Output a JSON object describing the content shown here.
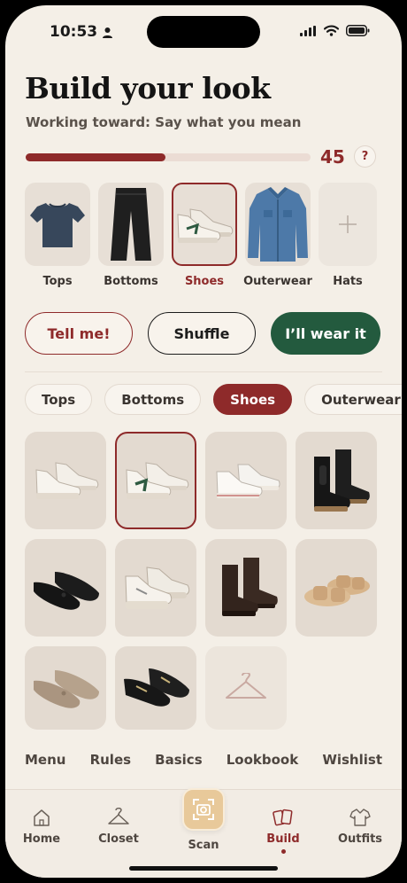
{
  "status": {
    "time": "10:53"
  },
  "header": {
    "title": "Build your look",
    "subtitle": "Working toward: Say what you mean",
    "score": "45",
    "progress_fraction": 0.49,
    "help_label": "?"
  },
  "slots": [
    {
      "label": "Tops",
      "icon": "tshirt-icon",
      "state": "filled"
    },
    {
      "label": "Bottoms",
      "icon": "jeans-icon",
      "state": "filled"
    },
    {
      "label": "Shoes",
      "icon": "sneaker-icon",
      "state": "selected"
    },
    {
      "label": "Outerwear",
      "icon": "denim-jacket-icon",
      "state": "filled"
    },
    {
      "label": "Hats",
      "icon": "plus-icon",
      "state": "empty"
    }
  ],
  "actions": {
    "tell": "Tell me!",
    "shuffle": "Shuffle",
    "wear": "I’ll wear it"
  },
  "filters": [
    {
      "label": "Tops",
      "active": false
    },
    {
      "label": "Bottoms",
      "active": false
    },
    {
      "label": "Shoes",
      "active": true
    },
    {
      "label": "Outerwear",
      "active": false
    }
  ],
  "grid_items": [
    "white-sneakers-icon",
    "white-sneakers-green-v-icon",
    "white-canvas-sneakers-icon",
    "black-chelsea-boots-icon",
    "black-ballet-flats-icon",
    "white-running-sneakers-icon",
    "brown-ankle-boots-icon",
    "tan-slide-sandals-icon",
    "taupe-ballet-flats-icon",
    "black-loafers-icon",
    "hanger-icon"
  ],
  "links": [
    "Menu",
    "Rules",
    "Basics",
    "Lookbook",
    "Wishlist"
  ],
  "tabs": {
    "home": "Home",
    "closet": "Closet",
    "scan": "Scan",
    "build": "Build",
    "outfits": "Outfits"
  },
  "colors": {
    "accent": "#8e2a2a",
    "green": "#235a3e",
    "background": "#f4efe7",
    "scan": "#e8c99a"
  }
}
